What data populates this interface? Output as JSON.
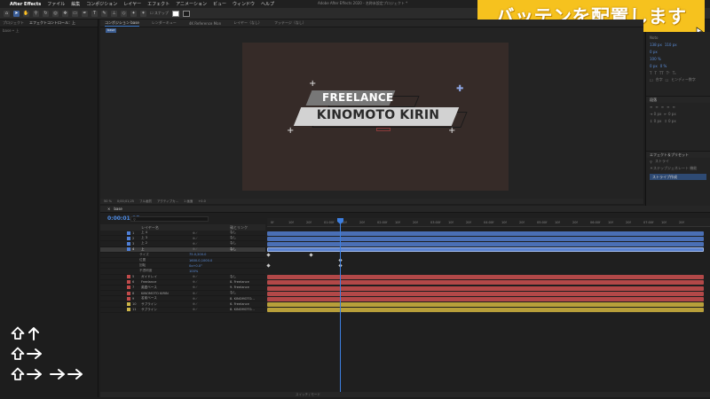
{
  "menubar": {
    "app": "After Effects",
    "items": [
      "ファイル",
      "編集",
      "コンポジション",
      "レイヤー",
      "エフェクト",
      "アニメーション",
      "ビュー",
      "ウィンドウ",
      "ヘルプ"
    ],
    "window_title": "Adobe After Effects 2020 - 名称未設定プロジェクト *"
  },
  "toolbar": {
    "snap_label": "スナップ"
  },
  "caption": {
    "text": "バッテンを配置します",
    "bg": "#f6c21e"
  },
  "left_panel": {
    "tabs": [
      "プロジェクト",
      "エフェクトコントロール：上"
    ],
    "subtab": "base • 上"
  },
  "comp_panel": {
    "tabs": [
      "コンポジション base",
      "レンダーキュー",
      "4K Reference Mon",
      "レイヤー（なし）",
      "フッテージ（なし）"
    ],
    "active_subtab": "base",
    "title_line1": "FREELANCE",
    "title_line2": "KINOMOTO KIRIN",
    "footer": [
      "50 %",
      "0;00;01;25",
      "フル画質",
      "アクティブカ...",
      "1 画面",
      "+0.0"
    ]
  },
  "right_panel": {
    "font": "Noto",
    "values": [
      "138 px",
      "110 px",
      "0 px",
      "100 %",
      "0 px",
      "0 %"
    ],
    "checkbox1": "合字",
    "checkbox2": "ヒンディー数字",
    "align_label": "段落",
    "effects_title": "エフェクト＆プリセット",
    "search_value": "ストライ",
    "category": "＊ステップジェネレート 機能",
    "highlight_item": "ストライプ作成"
  },
  "timeline": {
    "tab": "base",
    "timecode": "0:00:01:25",
    "search_placeholder": "",
    "header": {
      "source": "レイヤー名",
      "parent": "親とリンク"
    },
    "layers": [
      {
        "num": "1",
        "name": "上 4",
        "parent": "なし",
        "color": "#4f7fd6"
      },
      {
        "num": "2",
        "name": "上 3",
        "parent": "なし",
        "color": "#4f7fd6"
      },
      {
        "num": "3",
        "name": "上 2",
        "parent": "なし",
        "color": "#4f7fd6"
      },
      {
        "num": "4",
        "name": "上",
        "parent": "なし",
        "color": "#4f7fd6"
      }
    ],
    "props": [
      {
        "name": "サイズ",
        "value": "75.0,200.0"
      },
      {
        "name": "位置",
        "value": "1600.0,1000.0"
      },
      {
        "name": "回転",
        "value": "0x+0.0°"
      },
      {
        "name": "不透明度",
        "value": "100%"
      }
    ],
    "layers2": [
      {
        "num": "5",
        "name": "ガイドレイ",
        "parent": "なし",
        "color": "#c24b4b"
      },
      {
        "num": "6",
        "name": "Freelance",
        "parent": "8. Freelance",
        "color": "#c24b4b"
      },
      {
        "num": "7",
        "name": "英語ベース",
        "parent": "9. Freelance",
        "color": "#c24b4b"
      },
      {
        "num": "8",
        "name": "KINOMOTO KIRIN",
        "parent": "なし",
        "color": "#c24b4b"
      },
      {
        "num": "9",
        "name": "名前ベース",
        "parent": "8. KINOMOTO...",
        "color": "#c24b4b"
      },
      {
        "num": "10",
        "name": "サブライン",
        "parent": "6. Freelance",
        "color": "#cdb548"
      },
      {
        "num": "11",
        "name": "サブライン",
        "parent": "8. KINOMOTO...",
        "color": "#cdb548"
      }
    ],
    "ruler": [
      "0f",
      "10f",
      "20f",
      "01:00f",
      "10f",
      "20f",
      "02:00f",
      "10f",
      "20f",
      "03:00f",
      "10f",
      "20f",
      "04:00f",
      "10f",
      "20f",
      "05:00f",
      "10f",
      "20f",
      "06:00f",
      "10f",
      "20f",
      "07:00f",
      "10f",
      "20f"
    ],
    "footer": "スイッチ / モード"
  },
  "shortcuts": [
    {
      "keys": [
        "shift-up-icon",
        "arrow-up-icon"
      ]
    },
    {
      "keys": [
        "shift-up-icon",
        "arrow-right-icon"
      ]
    },
    {
      "keys": [
        "shift-up-icon",
        "arrow-right-icon",
        "arrow-right-icon",
        "arrow-right-icon"
      ]
    }
  ]
}
